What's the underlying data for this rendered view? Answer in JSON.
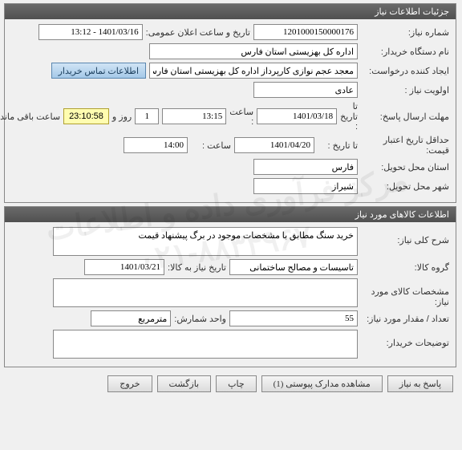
{
  "watermark": {
    "line1": "مرکز فرآوری داده و اطلاعات",
    "line2": "۰۲۱-۸۸۳۴۹۶۷۰"
  },
  "panel1": {
    "title": "جزئیات اطلاعات نیاز",
    "need_no_label": "شماره نیاز:",
    "need_no": "1201000150000176",
    "announce_label": "تاریخ و ساعت اعلان عمومی:",
    "announce": "1401/03/16 - 13:12",
    "buyer_label": "نام دستگاه خریدار:",
    "buyer": "اداره کل بهزیستی استان فارس",
    "requester_label": "ایجاد کننده درخواست:",
    "requester": "معجد عجم نوازی کارپرداز اداره کل بهزیستی استان فارس",
    "contact_btn": "اطلاعات تماس خریدار",
    "priority_label": "اولویت نیاز :",
    "priority": "عادى",
    "deadline_label": "مهلت ارسال پاسخ:",
    "to_date_label": "تا تاریخ :",
    "to_date1": "1401/03/18",
    "hour_label": "ساعت :",
    "hour1": "13:15",
    "days": "1",
    "days_label": "روز و",
    "remain": "23:10:58",
    "remain_label": "ساعت باقی مانده",
    "valid_label": "حداقل تاریخ اعتبار قیمت:",
    "to_date2": "1401/04/20",
    "hour2": "14:00",
    "province_label": "استان محل تحویل:",
    "province": "فارس",
    "city_label": "شهر محل تحویل:",
    "city": "شیراز"
  },
  "panel2": {
    "title": "اطلاعات کالاهای مورد نیاز",
    "desc_label": "شرح کلی نیاز:",
    "desc": "خرید سنگ مطابق با مشخصات موجود در برگ پیشنهاد قیمت",
    "group_label": "گروه کالا:",
    "group": "تاسیسات و مصالح ساختمانی",
    "need_date_label": "تاریخ نیاز به کالا:",
    "need_date": "1401/03/21",
    "spec_label": "مشخصات کالای مورد نیاز:",
    "spec": "",
    "qty_label": "تعداد / مقدار مورد نیاز:",
    "qty": "55",
    "unit_label": "واحد شمارش:",
    "unit": "مترمربع",
    "notes_label": "توضیحات خریدار:",
    "notes": ""
  },
  "footer": {
    "reply": "پاسخ به نیاز",
    "attach": "مشاهده مدارک پیوستی (1)",
    "print": "چاپ",
    "back": "بازگشت",
    "exit": "خروج"
  }
}
